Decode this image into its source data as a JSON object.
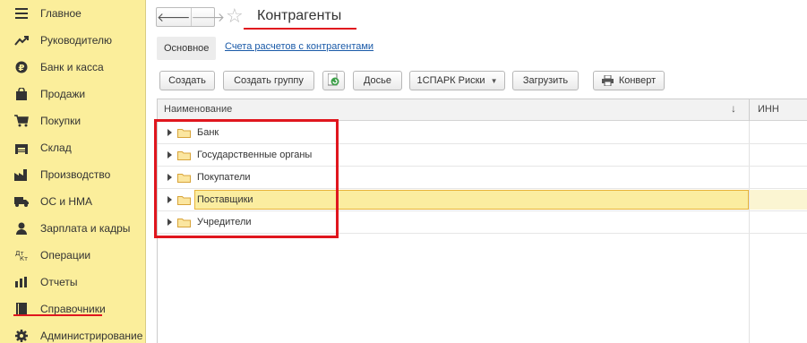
{
  "sidebar": {
    "items": [
      {
        "label": "Главное",
        "icon": "menu-lines-icon"
      },
      {
        "label": "Руководителю",
        "icon": "trend-chart-icon"
      },
      {
        "label": "Банк и касса",
        "icon": "coin-icon"
      },
      {
        "label": "Продажи",
        "icon": "shopping-bag-icon"
      },
      {
        "label": "Покупки",
        "icon": "shopping-cart-icon"
      },
      {
        "label": "Склад",
        "icon": "warehouse-icon"
      },
      {
        "label": "Производство",
        "icon": "factory-icon"
      },
      {
        "label": "ОС и НМА",
        "icon": "truck-icon"
      },
      {
        "label": "Зарплата и кадры",
        "icon": "person-icon"
      },
      {
        "label": "Операции",
        "icon": "debit-credit-icon"
      },
      {
        "label": "Отчеты",
        "icon": "bar-chart-icon"
      },
      {
        "label": "Справочники",
        "icon": "book-icon"
      },
      {
        "label": "Администрирование",
        "icon": "gear-icon"
      }
    ],
    "active_index": 11
  },
  "header": {
    "back": "🡐",
    "forward": "🡒",
    "star": "☆",
    "title": "Контрагенты"
  },
  "tabs": {
    "main": "Основное",
    "link": "Счета расчетов с контрагентами"
  },
  "toolbar": {
    "create": "Создать",
    "create_group": "Создать группу",
    "dossier": "Досье",
    "spark": "1СПАРК Риски",
    "load": "Загрузить",
    "envelope": "Конверт"
  },
  "table": {
    "col_name": "Наименование",
    "sort_icon": "↓",
    "col_inn": "ИНН",
    "rows": [
      {
        "label": "Банк"
      },
      {
        "label": "Государственные органы"
      },
      {
        "label": "Покупатели"
      },
      {
        "label": "Поставщики",
        "selected": true
      },
      {
        "label": "Учредители"
      }
    ]
  },
  "colors": {
    "sidebar_bg": "#fbee9b",
    "accent_red": "#e0161e",
    "link": "#1a5aa8",
    "selection": "#fbeda0"
  }
}
